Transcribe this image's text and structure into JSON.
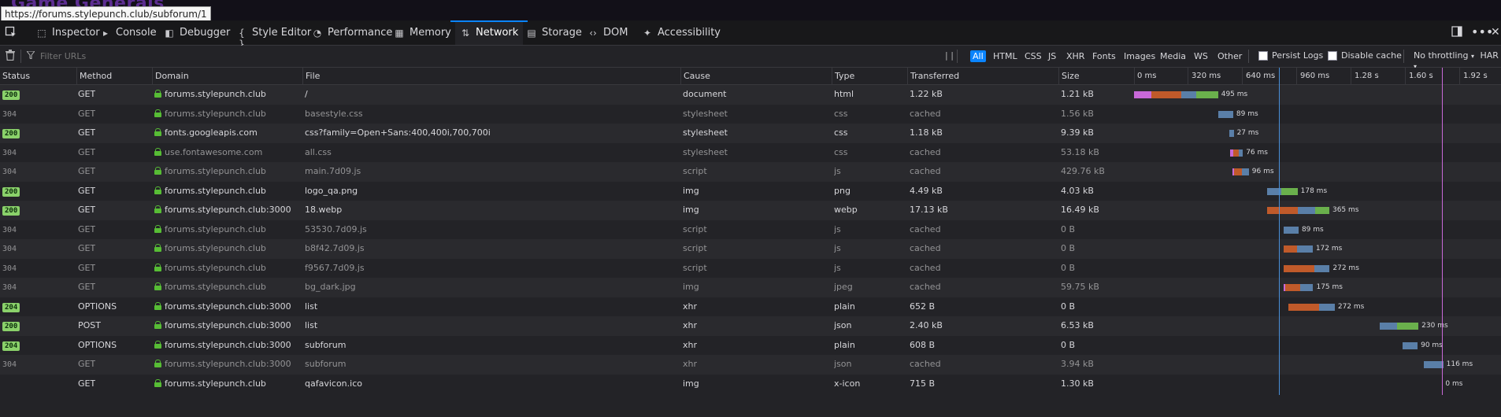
{
  "browser": {
    "background_title": "Game Generals",
    "url_tooltip": "https://forums.stylepunch.club/subforum/1"
  },
  "devtools": {
    "tabs": [
      {
        "label": "Inspector",
        "icon": "inspector-icon"
      },
      {
        "label": "Console",
        "icon": "console-icon"
      },
      {
        "label": "Debugger",
        "icon": "debugger-icon"
      },
      {
        "label": "Style Editor",
        "icon": "style-editor-icon"
      },
      {
        "label": "Performance",
        "icon": "performance-icon"
      },
      {
        "label": "Memory",
        "icon": "memory-icon"
      },
      {
        "label": "Network",
        "icon": "network-icon",
        "active": true
      },
      {
        "label": "Storage",
        "icon": "storage-icon"
      },
      {
        "label": "DOM",
        "icon": "dom-icon"
      },
      {
        "label": "Accessibility",
        "icon": "accessibility-icon"
      }
    ]
  },
  "toolbar": {
    "filter_placeholder": "Filter URLs",
    "pause_label": "| |",
    "types": [
      "All",
      "HTML",
      "CSS",
      "JS",
      "XHR",
      "Fonts",
      "Images",
      "Media",
      "WS",
      "Other"
    ],
    "active_type": "All",
    "persist_logs": "Persist Logs",
    "disable_cache": "Disable cache",
    "throttling": "No throttling",
    "har": "HAR"
  },
  "columns": {
    "status": "Status",
    "method": "Method",
    "domain": "Domain",
    "file": "File",
    "cause": "Cause",
    "type": "Type",
    "transferred": "Transferred",
    "size": "Size"
  },
  "timeline_ticks": [
    "0 ms",
    "320 ms",
    "640 ms",
    "960 ms",
    "1.28 s",
    "1.60 s",
    "1.92 s"
  ],
  "timeline_scale_ms_per_tick": 320,
  "colors": {
    "blocked": "#c869d8",
    "connect": "#c05a2a",
    "wait": "#5a7fa8",
    "receive": "#6ab04c",
    "dom_loaded": "#4a90d9",
    "load": "#c869d8",
    "status_ok": "#8ad16a"
  },
  "markers": {
    "dom_content_loaded_ms": 855,
    "load_ms": 1815
  },
  "requests": [
    {
      "status": "200",
      "method": "GET",
      "domain": "forums.stylepunch.club",
      "file": "/",
      "cause": "document",
      "type": "html",
      "transferred": "1.22 kB",
      "size": "1.21 kB",
      "cached": false,
      "duration": "495 ms",
      "start": 0,
      "segs": [
        [
          0,
          100,
          "blocked"
        ],
        [
          100,
          180,
          "connect"
        ],
        [
          280,
          85,
          "wait"
        ],
        [
          365,
          130,
          "receive"
        ]
      ]
    },
    {
      "status": "304",
      "method": "GET",
      "domain": "forums.stylepunch.club",
      "file": "basestyle.css",
      "cause": "stylesheet",
      "type": "css",
      "transferred": "cached",
      "size": "1.56 kB",
      "cached": true,
      "duration": "89 ms",
      "start": 495,
      "segs": [
        [
          0,
          89,
          "wait"
        ]
      ]
    },
    {
      "status": "200",
      "method": "GET",
      "domain": "fonts.googleapis.com",
      "file": "css?family=Open+Sans:400,400i,700,700i",
      "cause": "stylesheet",
      "type": "css",
      "transferred": "1.18 kB",
      "size": "9.39 kB",
      "cached": false,
      "duration": "27 ms",
      "start": 560,
      "segs": [
        [
          0,
          27,
          "wait"
        ]
      ]
    },
    {
      "status": "304",
      "method": "GET",
      "domain": "use.fontawesome.com",
      "file": "all.css",
      "cause": "stylesheet",
      "type": "css",
      "transferred": "cached",
      "size": "53.18 kB",
      "cached": true,
      "duration": "76 ms",
      "start": 565,
      "segs": [
        [
          0,
          20,
          "blocked"
        ],
        [
          20,
          30,
          "connect"
        ],
        [
          50,
          26,
          "wait"
        ]
      ]
    },
    {
      "status": "304",
      "method": "GET",
      "domain": "forums.stylepunch.club",
      "file": "main.7d09.js",
      "cause": "script",
      "type": "js",
      "transferred": "cached",
      "size": "429.76 kB",
      "cached": true,
      "duration": "96 ms",
      "start": 580,
      "segs": [
        [
          0,
          10,
          "blocked"
        ],
        [
          10,
          46,
          "connect"
        ],
        [
          56,
          40,
          "wait"
        ]
      ]
    },
    {
      "status": "200",
      "method": "GET",
      "domain": "forums.stylepunch.club",
      "file": "logo_qa.png",
      "cause": "img",
      "type": "png",
      "transferred": "4.49 kB",
      "size": "4.03 kB",
      "cached": false,
      "duration": "178 ms",
      "start": 785,
      "segs": [
        [
          0,
          80,
          "wait"
        ],
        [
          80,
          98,
          "receive"
        ]
      ]
    },
    {
      "status": "200",
      "method": "GET",
      "domain": "forums.stylepunch.club:3000",
      "file": "18.webp",
      "cause": "img",
      "type": "webp",
      "transferred": "17.13 kB",
      "size": "16.49 kB",
      "cached": false,
      "duration": "365 ms",
      "start": 785,
      "segs": [
        [
          0,
          180,
          "connect"
        ],
        [
          180,
          100,
          "wait"
        ],
        [
          280,
          85,
          "receive"
        ]
      ]
    },
    {
      "status": "304",
      "method": "GET",
      "domain": "forums.stylepunch.club",
      "file": "53530.7d09.js",
      "cause": "script",
      "type": "js",
      "transferred": "cached",
      "size": "0 B",
      "cached": true,
      "duration": "89 ms",
      "start": 880,
      "segs": [
        [
          0,
          89,
          "wait"
        ]
      ]
    },
    {
      "status": "304",
      "method": "GET",
      "domain": "forums.stylepunch.club",
      "file": "b8f42.7d09.js",
      "cause": "script",
      "type": "js",
      "transferred": "cached",
      "size": "0 B",
      "cached": true,
      "duration": "172 ms",
      "start": 880,
      "segs": [
        [
          0,
          80,
          "connect"
        ],
        [
          80,
          92,
          "wait"
        ]
      ]
    },
    {
      "status": "304",
      "method": "GET",
      "domain": "forums.stylepunch.club",
      "file": "f9567.7d09.js",
      "cause": "script",
      "type": "js",
      "transferred": "cached",
      "size": "0 B",
      "cached": true,
      "duration": "272 ms",
      "start": 880,
      "segs": [
        [
          0,
          180,
          "connect"
        ],
        [
          180,
          92,
          "wait"
        ]
      ]
    },
    {
      "status": "304",
      "method": "GET",
      "domain": "forums.stylepunch.club",
      "file": "bg_dark.jpg",
      "cause": "img",
      "type": "jpeg",
      "transferred": "cached",
      "size": "59.75 kB",
      "cached": true,
      "duration": "175 ms",
      "start": 880,
      "segs": [
        [
          0,
          10,
          "blocked"
        ],
        [
          10,
          90,
          "connect"
        ],
        [
          100,
          75,
          "wait"
        ]
      ]
    },
    {
      "status": "204",
      "method": "OPTIONS",
      "domain": "forums.stylepunch.club:3000",
      "file": "list",
      "cause": "xhr",
      "type": "plain",
      "transferred": "652 B",
      "size": "0 B",
      "cached": false,
      "duration": "272 ms",
      "start": 910,
      "segs": [
        [
          0,
          180,
          "connect"
        ],
        [
          180,
          92,
          "wait"
        ]
      ]
    },
    {
      "status": "200",
      "method": "POST",
      "domain": "forums.stylepunch.club:3000",
      "file": "list",
      "cause": "xhr",
      "type": "json",
      "transferred": "2.40 kB",
      "size": "6.53 kB",
      "cached": false,
      "duration": "230 ms",
      "start": 1445,
      "segs": [
        [
          0,
          105,
          "wait"
        ],
        [
          105,
          125,
          "receive"
        ]
      ]
    },
    {
      "status": "204",
      "method": "OPTIONS",
      "domain": "forums.stylepunch.club:3000",
      "file": "subforum",
      "cause": "xhr",
      "type": "plain",
      "transferred": "608 B",
      "size": "0 B",
      "cached": false,
      "duration": "90 ms",
      "start": 1580,
      "segs": [
        [
          0,
          90,
          "wait"
        ]
      ]
    },
    {
      "status": "304",
      "method": "GET",
      "domain": "forums.stylepunch.club:3000",
      "file": "subforum",
      "cause": "xhr",
      "type": "json",
      "transferred": "cached",
      "size": "3.94 kB",
      "cached": true,
      "duration": "116 ms",
      "start": 1705,
      "segs": [
        [
          0,
          116,
          "wait"
        ]
      ]
    },
    {
      "status": "",
      "method": "GET",
      "domain": "forums.stylepunch.club",
      "file": "qafavicon.ico",
      "cause": "img",
      "type": "x-icon",
      "transferred": "715 B",
      "size": "1.30 kB",
      "cached": false,
      "duration": "0 ms",
      "start": 1815,
      "segs": []
    }
  ]
}
